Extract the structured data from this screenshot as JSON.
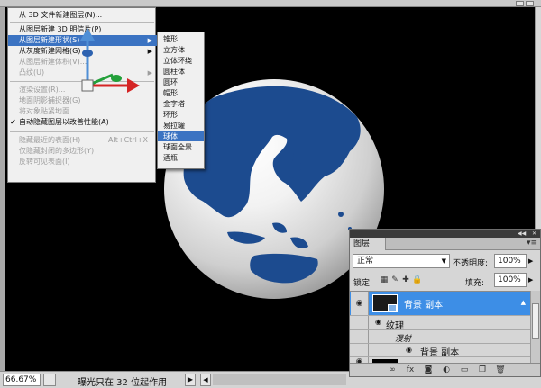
{
  "menu_3d": {
    "items": [
      {
        "label": "从 3D 文件新建图层(N)..."
      },
      {
        "label": "从图层新建 3D 明信片(P)"
      },
      {
        "label": "从图层新建形状(S)"
      },
      {
        "label": "从灰度新建网格(G)"
      },
      {
        "label": "从图层新建体积(V)..."
      },
      {
        "label": "凸纹(U)"
      },
      {
        "label": "渲染设置(R)..."
      },
      {
        "label": "地面阴影捕捉器(G)"
      },
      {
        "label": "将对象贴紧地面"
      },
      {
        "label": "自动隐藏图层以改善性能(A)"
      },
      {
        "label": "隐藏最近的表面(H)",
        "shortcut": "Alt+Ctrl+X"
      },
      {
        "label": "仅隐藏封闭的多边形(Y)"
      },
      {
        "label": "反转可见表面(I)"
      }
    ]
  },
  "submenu_shapes": {
    "items": [
      "锥形",
      "立方体",
      "立体环绕",
      "圆柱体",
      "圆环",
      "帽形",
      "金字塔",
      "环形",
      "易拉罐",
      "球体",
      "球面全景",
      "酒瓶"
    ]
  },
  "status_bar": {
    "zoom": "66.67%",
    "text": "曝光只在 32 位起作用",
    "arrow": "▶"
  },
  "layers_panel": {
    "tab_label": "图层",
    "blend_mode": "正常",
    "opacity_label": "不透明度:",
    "opacity_value": "100%",
    "lock_label": "锁定:",
    "fill_label": "填充:",
    "fill_value": "100%",
    "layers": [
      {
        "name": "背景 副本"
      },
      {
        "name": "纹理"
      },
      {
        "name": "漫射"
      },
      {
        "name": "背景 副本"
      }
    ]
  },
  "colors": {
    "menu_highlight": "#3b73c2",
    "layer_selected": "#3d8ee6",
    "globe_land": "#1c4b8f"
  }
}
